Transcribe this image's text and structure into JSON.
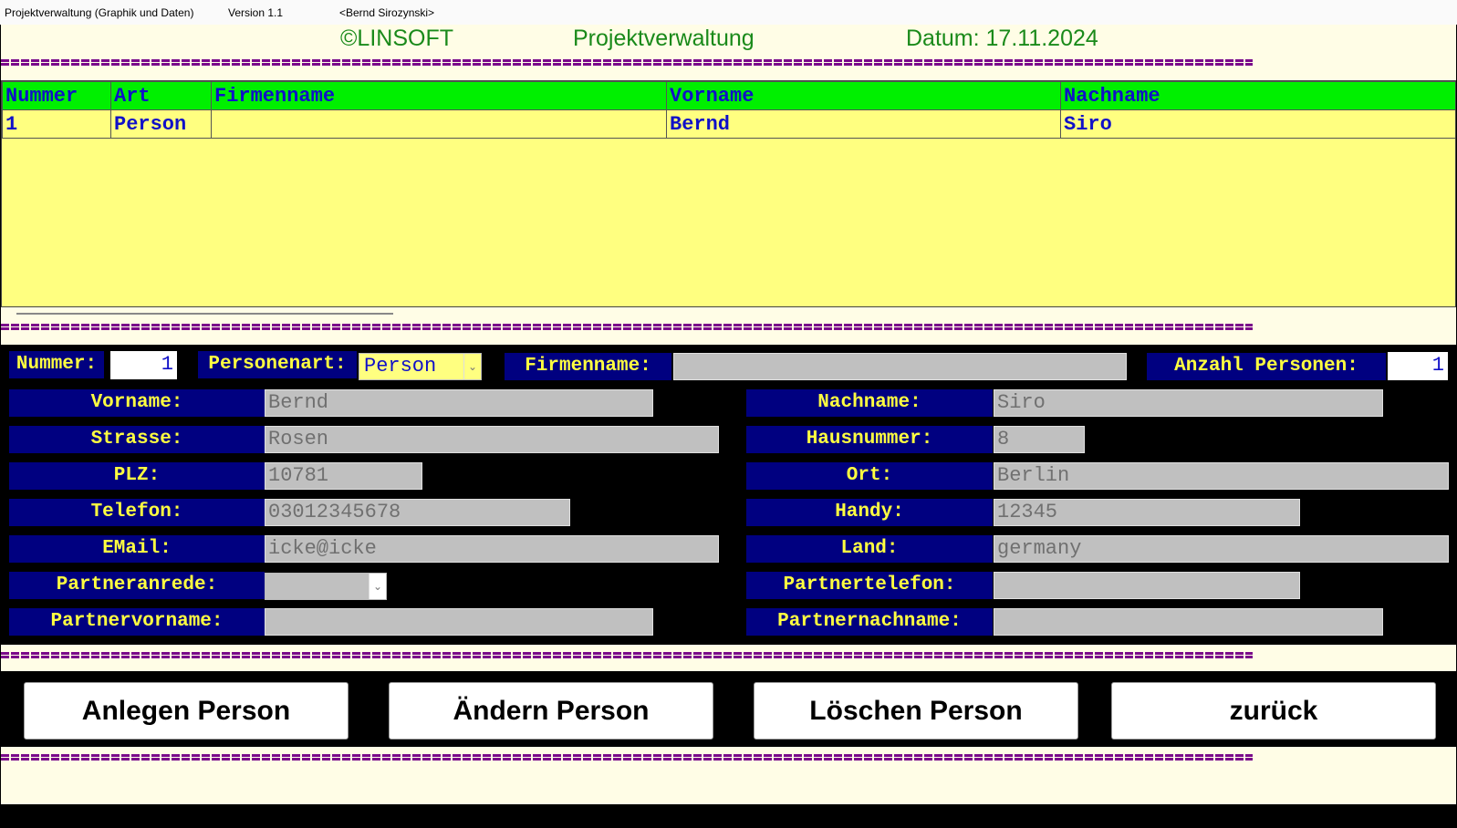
{
  "titlebar": {
    "app_title": "Projektverwaltung (Graphik und Daten)",
    "version": "Version 1.1",
    "user": "<Bernd Sirozynski>"
  },
  "header": {
    "copyright": "©LINSOFT",
    "title": "Projektverwaltung",
    "date": "Datum: 17.11.2024"
  },
  "grid": {
    "columns": [
      "Nummer",
      "Art",
      "Firmenname",
      "Vorname",
      "Nachname"
    ],
    "rows": [
      [
        "1",
        "Person",
        "",
        "Bernd",
        "Siro"
      ]
    ]
  },
  "form": {
    "nummer_label": "Nummer:",
    "nummer_value": "1",
    "personenart_label": "Personenart:",
    "personenart_value": "Person",
    "firmenname_label": "Firmenname:",
    "firmenname_value": "",
    "anzahl_label": "Anzahl Personen:",
    "anzahl_value": "1",
    "vorname_label": "Vorname:",
    "vorname_value": "Bernd",
    "nachname_label": "Nachname:",
    "nachname_value": "Siro",
    "strasse_label": "Strasse:",
    "strasse_value": "Rosen",
    "hausnummer_label": "Hausnummer:",
    "hausnummer_value": "8",
    "plz_label": "PLZ:",
    "plz_value": "10781",
    "ort_label": "Ort:",
    "ort_value": "Berlin",
    "telefon_label": "Telefon:",
    "telefon_value": "03012345678",
    "handy_label": "Handy:",
    "handy_value": "12345",
    "email_label": "EMail:",
    "email_value": "icke@icke",
    "land_label": "Land:",
    "land_value": "germany",
    "partneranrede_label": "Partneranrede:",
    "partneranrede_value": "",
    "partnertelefon_label": "Partnertelefon:",
    "partnertelefon_value": "",
    "partnervorname_label": "Partnervorname:",
    "partnervorname_value": "",
    "partnernachname_label": "Partnernachname:",
    "partnernachname_value": ""
  },
  "buttons": {
    "anlegen": "Anlegen Person",
    "aendern": "Ändern Person",
    "loeschen": "Löschen Person",
    "zurueck": "zurück"
  },
  "colors": {
    "grid_background": "#ffff80",
    "grid_header": "#00f000",
    "label_background": "#000080",
    "label_text": "#ffff40",
    "header_text": "#1a8a1a",
    "separator": "#7a0a8a"
  }
}
